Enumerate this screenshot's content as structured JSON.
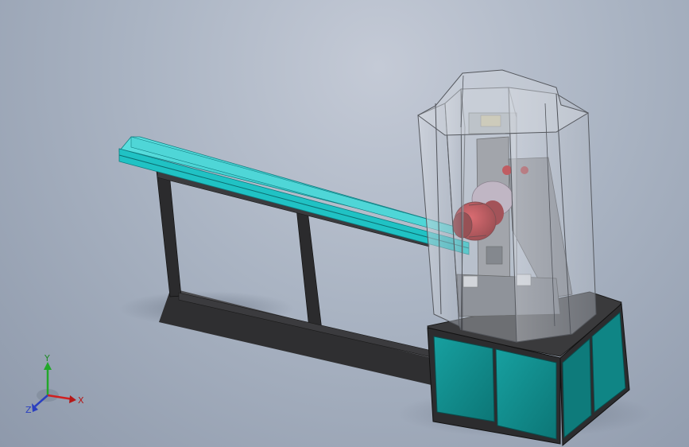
{
  "viewport": {
    "background_top": "#c4cad6",
    "background_bottom": "#8e99ab"
  },
  "colors": {
    "rail": "#25c7c8",
    "frame": "#3a3a3a",
    "cabinet": "#118c8c",
    "motor": "#b31117",
    "enclosure_glass": "#c7ccd4"
  },
  "triad": {
    "x_label": "X",
    "y_label": "Y",
    "z_label": "Z"
  }
}
